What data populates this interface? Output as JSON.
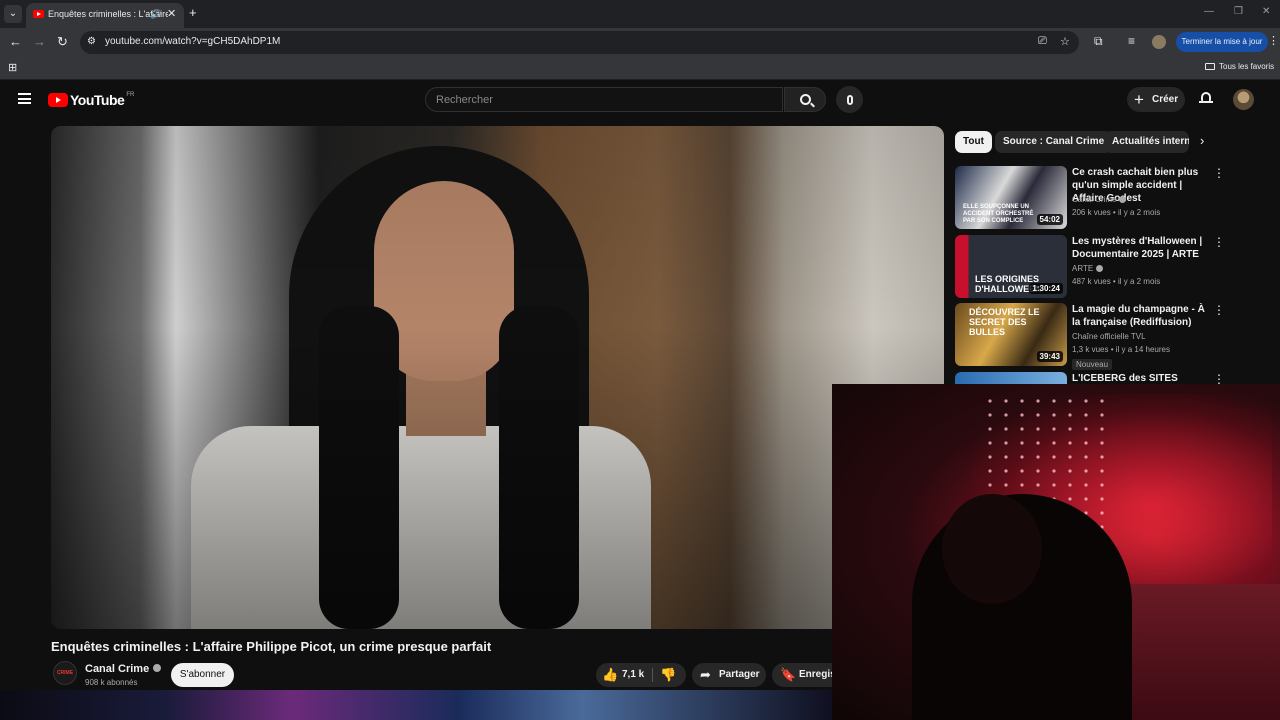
{
  "browser": {
    "tab_title": "Enquêtes criminelles : L'affaire",
    "url": "youtube.com/watch?v=gCH5DAhDP1M",
    "update_button": "Terminer la mise à jour",
    "bookmarks_all": "Tous les favoris",
    "icons": {
      "back": "←",
      "forward": "→",
      "reload": "↻",
      "tune": "⚙",
      "cast": "⎚",
      "star": "☆",
      "extensions": "⧉",
      "media": "≡",
      "apps": "⊞",
      "close": "✕",
      "plus": "+",
      "chevron_down": "⌄",
      "minimize": "—",
      "restore": "❐",
      "window_close": "✕",
      "kebab": "⋮",
      "audio": "🔊"
    }
  },
  "youtube": {
    "logo_text": "YouTube",
    "country_code": "FR",
    "search_placeholder": "Rechercher",
    "create_label": "Créer",
    "video": {
      "title": "Enquêtes criminelles : L'affaire Philippe Picot, un crime presque parfait",
      "channel_name": "Canal Crime",
      "channel_avatar_text": "CRIME",
      "subscribers": "908 k abonnés",
      "subscribe_label": "S'abonner",
      "likes": "7,1 k",
      "share_label": "Partager",
      "save_label": "Enregistrer"
    },
    "chips": [
      {
        "label": "Tout",
        "active": true
      },
      {
        "label": "Source : Canal Crime",
        "active": false
      },
      {
        "label": "Actualités internationales",
        "active": false
      }
    ],
    "recommendations": [
      {
        "title": "Ce crash cachait bien plus qu'un simple accident | Affaire Godest",
        "channel": "Canal Crime",
        "verified": true,
        "views": "206 k vues",
        "age": "il y a 2 mois",
        "duration": "54:02",
        "thumb_text": "ELLE SOUPÇONNE UN ACCIDENT ORCHESTRÉ PAR SON COMPLICE"
      },
      {
        "title": "Les mystères d'Halloween | Documentaire 2025 | ARTE",
        "channel": "ARTE",
        "verified": true,
        "views": "487 k vues",
        "age": "il y a 2 mois",
        "duration": "1:30:24",
        "thumb_text": "LES ORIGINES D'HALLOWEEN"
      },
      {
        "title": "La magie du champagne - À la française (Rediffusion)",
        "channel": "Chaîne officielle TVL",
        "verified": false,
        "views": "1,3 k vues",
        "age": "il y a 14 heures",
        "duration": "39:43",
        "badge": "Nouveau",
        "thumb_text": "DÉCOUVREZ LE SECRET DES BULLES"
      },
      {
        "title": "L'ICEBERG des SITES INTERNET",
        "channel": "",
        "verified": false,
        "views": "",
        "age": "",
        "duration": "",
        "thumb_text": ""
      }
    ]
  }
}
